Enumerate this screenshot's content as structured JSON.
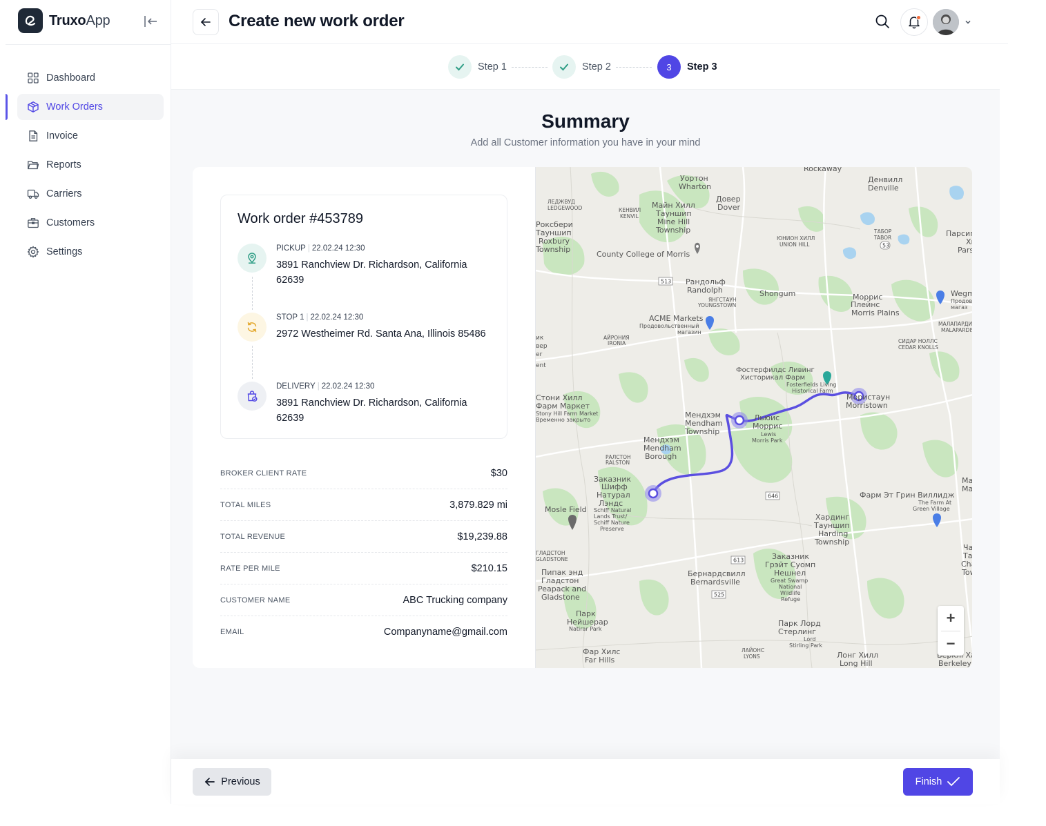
{
  "brand": {
    "name_bold": "Truxo",
    "name_light": "App"
  },
  "sidebar": {
    "items": [
      {
        "label": "Dashboard",
        "icon": "grid-icon",
        "active": false
      },
      {
        "label": "Work Orders",
        "icon": "box-icon",
        "active": true
      },
      {
        "label": "Invoice",
        "icon": "document-icon",
        "active": false
      },
      {
        "label": "Reports",
        "icon": "folder-icon",
        "active": false
      },
      {
        "label": "Carriers",
        "icon": "truck-icon",
        "active": false
      },
      {
        "label": "Customers",
        "icon": "briefcase-icon",
        "active": false
      },
      {
        "label": "Settings",
        "icon": "gear-icon",
        "active": false
      }
    ]
  },
  "header": {
    "title": "Create new work order"
  },
  "stepper": {
    "steps": [
      {
        "label": "Step 1",
        "status": "done"
      },
      {
        "label": "Step 2",
        "status": "done"
      },
      {
        "label": "Step 3",
        "status": "current",
        "number": "3"
      }
    ]
  },
  "summary": {
    "title": "Summary",
    "subtitle": "Add all Customer information you have in your mind"
  },
  "work_order": {
    "title": "Work order #453789",
    "stops": [
      {
        "type": "PICKUP",
        "datetime": "22.02.24 12:30",
        "address": "3891 Ranchview Dr. Richardson, California 62639"
      },
      {
        "type": "STOP 1",
        "datetime": "22.02.24 12:30",
        "address": "2972 Westheimer Rd. Santa Ana, Illinois 85486"
      },
      {
        "type": "DELIVERY",
        "datetime": "22.02.24 12:30",
        "address": "3891 Ranchview Dr. Richardson, California 62639"
      }
    ]
  },
  "details": [
    {
      "label": "BROKER CLIENT RATE",
      "value": "$30"
    },
    {
      "label": "TOTAL MILES",
      "value": "3,879.829 mi"
    },
    {
      "label": "TOTAL REVENUE",
      "value": "$19,239.88"
    },
    {
      "label": "RATE PER MILE",
      "value": "$210.15"
    },
    {
      "label": "CUSTOMER NAME",
      "value": "ABC Trucking company"
    },
    {
      "label": "EMAIL",
      "value": "Companyname@gmail.com"
    }
  ],
  "map": {
    "labels": {
      "rockaway": "Rockaway",
      "wharton_ru": "Уортон",
      "wharton": "Wharton",
      "denville_ru": "Денвилл",
      "denville": "Denville",
      "dover_ru": "Довер",
      "dover": "Dover",
      "ledgewood_ru": "ЛЕДЖВУД",
      "ledgewood": "LEDGEWOOD",
      "kenvil_ru": "КЕНВИЛ",
      "kenvil": "KENVIL",
      "mine_hill_ru": "Майн Хилл",
      "mine_hill_ru2": "Тауншип",
      "mine_hill": "Mine Hill",
      "mine_hill2": "Township",
      "roxbury_ru": "Роксбери",
      "roxbury_ru2": "Тауншип",
      "roxbury": "Roxbury",
      "roxbury2": "Township",
      "tabor_ru": "ТАБОР",
      "tabor": "TABOR",
      "union_hill_ru": "ЮНИОН ХИЛЛ",
      "union_hill": "UNION HILL",
      "parsippany_ru": "Парсип",
      "parsippany": "Parsip",
      "county_college": "County College of Morris",
      "randolph_ru": "Рандольф",
      "randolph": "Randolph",
      "youngstown_ru": "ЯНГСТАУН",
      "youngstown": "YOUNGSTOWN",
      "shongum": "Shongum",
      "morris_plains_ru": "Моррис",
      "morris_plains_ru2": "Плейнс",
      "morris_plains": "Morris Plains",
      "wegmans": "Wegm",
      "acme": "ACME Markets",
      "acme_ru": "Продовольственный",
      "acme_ru2": "магазин",
      "ironia_ru": "АЙРОНИЯ",
      "ironia": "IRONIA",
      "malapardis_ru": "МАЛАПАРДИС",
      "malapardis": "MALAPARDIS",
      "cedar_knolls_ru": "СИДАР НОЛЛС",
      "cedar_knolls": "CEDAR KNOLLS",
      "fosterfields_ru": "Фостерфилдс Ливинг",
      "fosterfields_ru2": "Хисторикал Фарм",
      "fosterfields": "Fosterfields Living",
      "fosterfields2": "Historical Farm",
      "morristown_ru": "Мористаун",
      "morristown": "Morristown",
      "stony_hill_ru": "Стони Хилл",
      "stony_hill_ru2": "Фарм Маркет",
      "stony_hill": "Stony Hill Farm Market",
      "stony_hill2": "Временно закрыто",
      "mendham_tw_ru": "Мендхэм",
      "mendham_tw": "Mendham",
      "mendham_tw2": "Township",
      "lewis_morris_ru": "Льюис",
      "lewis_morris_ru2": "Моррис",
      "lewis_morris": "Lewis",
      "lewis_morris2": "Morris Park",
      "mendham_b_ru": "Мендхэм",
      "mendham_b": "Mendham",
      "mendham_b2": "Borough",
      "ralston_ru": "РАЛСТОН",
      "ralston": "RALSTON",
      "schiff_ru": "Заказник",
      "schiff_ru2": "Шифф",
      "schiff_ru3": "Натурал",
      "schiff_ru4": "Лэндс",
      "schiff": "Schiff Natural",
      "schiff2": "Lands Trust/",
      "schiff3": "Schiff Nature",
      "schiff4": "Preserve",
      "mosle": "Mosle Field",
      "green_village_ru": "Фарм Эт Грин Виллидж",
      "green_village": "The Farm At",
      "green_village2": "Green Village",
      "harding_ru": "Хардинг",
      "harding_ru2": "Тауншип",
      "harding": "Harding",
      "harding2": "Township",
      "gladstone_ru": "ГЛАДСТОН",
      "gladstone": "GLADSTONE",
      "great_swamp_ru": "Заказник",
      "great_swamp_ru2": "Грэйт Суомп",
      "great_swamp_ru3": "Нешнел",
      "great_swamp": "Great Swamp",
      "great_swamp2": "National",
      "great_swamp3": "Wildlife",
      "great_swamp4": "Refuge",
      "peapack_ru": "Пипак энд",
      "peapack_ru2": "Гладстон",
      "peapack": "Peapack and",
      "peapack2": "Gladstone",
      "bernardsville_ru": "Бернардсвилл",
      "bernardsville": "Bernardsville",
      "natirar_ru": "Парк",
      "natirar_ru2": "Нейшерар",
      "natirar": "Natirar Park",
      "stirling_ru": "Парк Лорд",
      "stirling_ru2": "Стерлинг",
      "stirling": "Lord",
      "stirling2": "Stirling Park",
      "far_hills_ru": "Фар Хилс",
      "far_hills": "Far Hills",
      "lyons_ru": "ЛАЙОНС",
      "lyons": "LYONS",
      "long_hill_ru": "Лонг Хилл",
      "long_hill": "Long Hill",
      "berkeley_ru": "Берклі Хайт",
      "berkeley": "Berkeley",
      "edge_ma": "Ма",
      "edge_ma2": "Ма",
      "edge_tay": "Чау",
      "edge_tay2": "Тау",
      "edge_tay3": "Cha",
      "edge_tay4": "Tow",
      "edge_x": "Хи",
      "edge_parsip2": "Parsip",
      "edge_ik": "ик",
      "edge_ver": "вер",
      "edge_er": "er",
      "edge_ent": "ent",
      "wegmans_ru": "Продов",
      "wegmans_ru2": "магаз",
      "road_513": "513",
      "road_53": "53",
      "road_646": "646",
      "road_613": "613",
      "road_525": "525"
    },
    "zoom_in": "+",
    "zoom_out": "−"
  },
  "footer": {
    "previous_label": "Previous",
    "finish_label": "Finish"
  },
  "colors": {
    "accent": "#5046e5",
    "route": "#5b4fe0",
    "pickup_bg": "#e6f4f1",
    "stop_bg": "#fdf6e3",
    "delivery_bg": "#eef0f4"
  }
}
